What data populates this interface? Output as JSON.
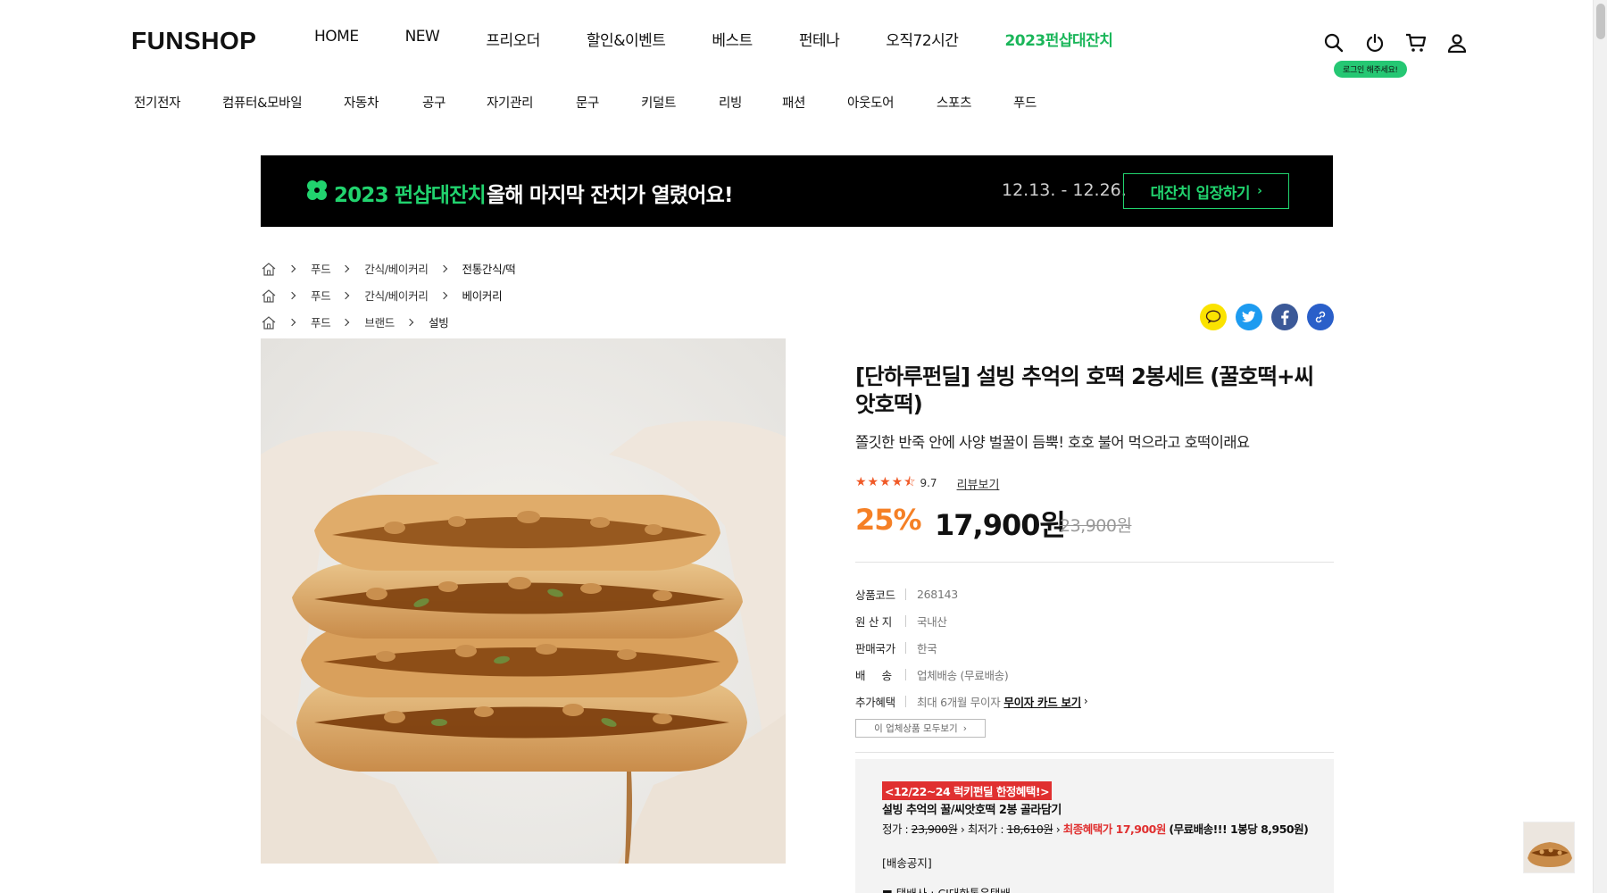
{
  "header": {
    "logo": "FUNSHOP",
    "nav": [
      "HOME",
      "NEW",
      "프리오더",
      "할인&이벤트",
      "베스트",
      "펀테나",
      "오직72시간",
      "2023펀샵대잔치"
    ],
    "login_badge": "로그인 해주세요!",
    "categories": [
      "전기전자",
      "컴퓨터&모바일",
      "자동차",
      "공구",
      "자기관리",
      "문구",
      "키덜트",
      "리빙",
      "패션",
      "아웃도어",
      "스포츠",
      "푸드"
    ]
  },
  "banner": {
    "title": "2023 펀샵대잔치",
    "subtitle": "올해 마지막 잔치가 열렸어요!",
    "date": "12.13. - 12.26.",
    "button": "대잔치 입장하기"
  },
  "breadcrumbs": [
    [
      "푸드",
      "간식/베이커리",
      "전통간식/떡"
    ],
    [
      "푸드",
      "간식/베이커리",
      "베이커리"
    ],
    [
      "푸드",
      "브랜드",
      "설빙"
    ]
  ],
  "product": {
    "title": "[단하루펀딜] 설빙 추억의 호떡 2봉세트 (꿀호떡+씨앗호떡)",
    "description": "쫄깃한 반죽 안에 사양 벌꿀이 듬뿍! 호호 불어 먹으라고 호떡이래요",
    "rating": "9.7",
    "review_link": "리뷰보기",
    "discount": "25%",
    "price": "17,900원",
    "original_price": "23,900원",
    "specs": [
      {
        "key": "상품코드",
        "value": "268143"
      },
      {
        "key": "원 산 지",
        "value": "국내산"
      },
      {
        "key": "판매국가",
        "value": "한국"
      },
      {
        "key": "배     송",
        "value": "업체배송 (무료배송)"
      },
      {
        "key": "추가혜택",
        "value": "최대 6개월 무이자",
        "link": "무이자 카드 보기"
      }
    ],
    "all_products_button": "이 업체상품 모두보기"
  },
  "notice": {
    "tag": "<12/22~24 럭키펀딜 한정혜택!>",
    "line2": "설빙 추억의 꿀/씨앗호떡 2봉 골라담기",
    "regular_label": "정가 : ",
    "regular_price": "23,900원",
    "lowest_label": "최저가 : ",
    "lowest_price": "18,610원",
    "final_benefit": "최종혜택가 17,900원",
    "shipping_note": "(무료배송!!! 1봉당 8,950원)",
    "line4": "[배송공지]",
    "line5": "■ 택배사 : CJ대한통운택배"
  },
  "colors": {
    "accent_green": "#21d36e",
    "discount_orange": "#f58026",
    "red": "#e03030"
  }
}
